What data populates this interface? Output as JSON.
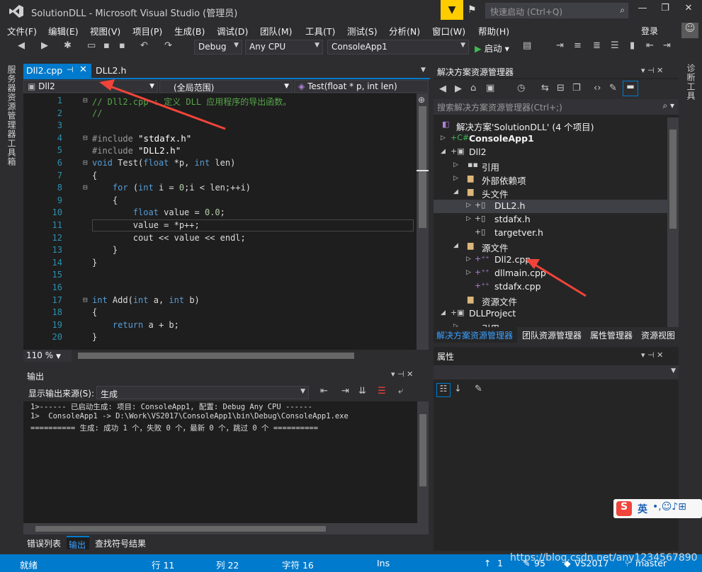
{
  "window": {
    "title": "SolutionDLL - Microsoft Visual Studio (管理员)",
    "quick_launch": "快速启动 (Ctrl+Q)",
    "signin": "登录"
  },
  "menu": [
    "文件(F)",
    "编辑(E)",
    "视图(V)",
    "项目(P)",
    "生成(B)",
    "调试(D)",
    "团队(M)",
    "工具(T)",
    "测试(S)",
    "分析(N)",
    "窗口(W)",
    "帮助(H)"
  ],
  "toolbar": {
    "config": "Debug",
    "platform": "Any CPU",
    "startup_project": "ConsoleApp1",
    "start_label": "启动"
  },
  "left_strip": {
    "server_explorer": "服务器资源管理器",
    "toolbox": "工具箱"
  },
  "right_strip": {
    "diagnostics": "诊断工具"
  },
  "editor": {
    "tabs": [
      {
        "label": "Dll2.cpp",
        "active": true
      },
      {
        "label": "DLL2.h",
        "active": false
      }
    ],
    "nav": {
      "project": "Dll2",
      "scope": "(全局范围)",
      "member": "Test(float * p, int len)"
    },
    "zoom": "110 %",
    "line_numbers": [
      "1",
      "2",
      "3",
      "4",
      "5",
      "6",
      "7",
      "8",
      "9",
      "10",
      "11",
      "12",
      "13",
      "14",
      "15",
      "16",
      "17",
      "18",
      "19",
      "20"
    ],
    "lines": [
      "// Dll2.cpp : 定义 DLL 应用程序的导出函数。",
      "//",
      "",
      "#include \"stdafx.h\"",
      "#include \"DLL2.h\"",
      "void Test(float *p, int len)",
      "{",
      "    for (int i = 0;i < len;++i)",
      "    {",
      "        float value = 0.0;",
      "        value = *p++;",
      "        cout << value << endl;",
      "    }",
      "}",
      "",
      "",
      "int Add(int a, int b)",
      "{",
      "    return a + b;",
      "}"
    ]
  },
  "output": {
    "title": "输出",
    "source_label": "显示输出来源(S):",
    "source_value": "生成",
    "lines": [
      "1>------ 已启动生成: 项目: ConsoleApp1, 配置: Debug Any CPU ------",
      "1>  ConsoleApp1 -> D:\\Work\\VS2017\\ConsoleApp1\\bin\\Debug\\ConsoleApp1.exe",
      "========== 生成: 成功 1 个，失败 0 个，最新 0 个，跳过 0 个 =========="
    ]
  },
  "bottom_tabs": [
    "错误列表",
    "输出",
    "查找符号结果"
  ],
  "solution_explorer": {
    "title": "解决方案资源管理器",
    "search_placeholder": "搜索解决方案资源管理器(Ctrl+;)",
    "items": [
      {
        "label": "解决方案'SolutionDLL' (4 个项目)"
      },
      {
        "label": "ConsoleApp1"
      },
      {
        "label": "Dll2"
      },
      {
        "label": "引用"
      },
      {
        "label": "外部依赖项"
      },
      {
        "label": "头文件"
      },
      {
        "label": "DLL2.h"
      },
      {
        "label": "stdafx.h"
      },
      {
        "label": "targetver.h"
      },
      {
        "label": "源文件"
      },
      {
        "label": "Dll2.cpp"
      },
      {
        "label": "dllmain.cpp"
      },
      {
        "label": "stdafx.cpp"
      },
      {
        "label": "资源文件"
      },
      {
        "label": "DLLProject"
      },
      {
        "label": "引用"
      }
    ],
    "tabs": [
      "解决方案资源管理器",
      "团队资源管理器",
      "属性管理器",
      "资源视图"
    ]
  },
  "properties": {
    "title": "属性"
  },
  "status": {
    "ready": "就绪",
    "line": "行 11",
    "col": "列 22",
    "char": "字符 16",
    "mode": "Ins",
    "up_count": "1",
    "edits": "95",
    "repo": "VS2017",
    "branch": "master"
  },
  "watermark": "https://blog.csdn.net/any1234567890",
  "ime": {
    "label": "英"
  },
  "colors": {
    "accent": "#007acc",
    "arrow": "#f0443a",
    "notify": "#ffcc00"
  }
}
